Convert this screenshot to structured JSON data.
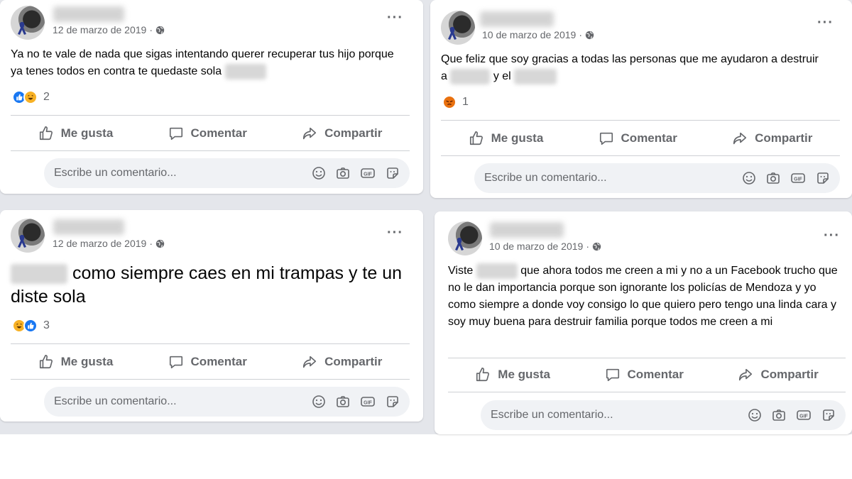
{
  "posts": [
    {
      "date": "12 de marzo de 2019",
      "dot": "·",
      "text_parts": [
        "Ya no te vale de nada que sigas intentando querer recuperar tus hijo porque ya tenes todos en contra te quedaste sola"
      ],
      "reaction_count": "2",
      "reaction_types": [
        "like",
        "haha"
      ]
    },
    {
      "date": "10 de marzo de 2019",
      "dot": "·",
      "text_parts": [
        "Que feliz que soy gracias a todas las personas que me ayudaron a destruir a",
        "y el"
      ],
      "reaction_count": "1",
      "reaction_types": [
        "angry"
      ]
    },
    {
      "date": "12 de marzo de 2019",
      "dot": "·",
      "text_parts": [
        "como siempre caes en mi trampas y te un diste sola"
      ],
      "reaction_count": "3",
      "reaction_types": [
        "haha",
        "like"
      ]
    },
    {
      "date": "10 de marzo de 2019",
      "dot": "·",
      "text_parts": [
        "Viste",
        "que ahora todos me creen a mi  y no a un Facebook trucho que no le dan importancia porque son ignorante los policías de Mendoza y yo como siempre a donde voy consigo lo que quiero pero tengo una linda cara y soy muy buena para  destruir familia porque todos me creen a mi"
      ],
      "reaction_count": "",
      "reaction_types": []
    }
  ],
  "actions": {
    "like": "Me gusta",
    "comment": "Comentar",
    "share": "Compartir"
  },
  "comment_placeholder": "Escribe un comentario...",
  "icons": {
    "more": "more-options-icon",
    "privacy": "globe-icon",
    "like": "thumbs-up-icon",
    "comment": "speech-bubble-icon",
    "share": "share-arrow-icon",
    "emoji": "smiley-icon",
    "camera": "camera-icon",
    "gif": "gif-icon",
    "sticker": "sticker-icon"
  },
  "colors": {
    "accent": "#1877f2",
    "text_secondary": "#65676b",
    "background": "#e4e6eb"
  }
}
